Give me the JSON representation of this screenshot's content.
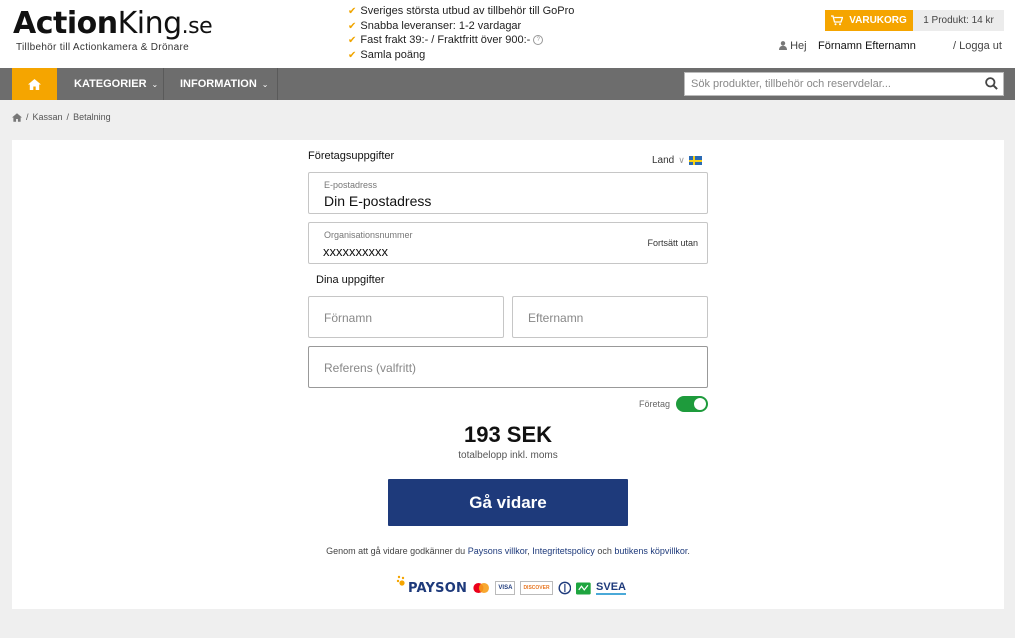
{
  "brand": {
    "logo_action": "Action",
    "logo_king": "King",
    "logo_tld": ".se",
    "tagline": "Tillbehör till Actionkamera & Drönare"
  },
  "usps": [
    "Sveriges största utbud av tillbehör till GoPro",
    "Snabba leveranser: 1-2 vardagar",
    "Fast frakt 39:- / Fraktfritt över 900:-",
    "Samla poäng"
  ],
  "cart": {
    "label": "VARUKORG",
    "summary": "1 Produkt: 14 kr"
  },
  "user": {
    "greeting": "Hej",
    "name": "Förnamn Efternamn",
    "logout": "/ Logga ut"
  },
  "nav": {
    "items": [
      "KATEGORIER",
      "INFORMATION"
    ]
  },
  "search": {
    "placeholder": "Sök produkter, tillbehör och reservdelar..."
  },
  "breadcrumb": {
    "items": [
      "Kassan",
      "Betalning"
    ]
  },
  "checkout": {
    "company_section": "Företagsuppgifter",
    "country_label": "Land",
    "email": {
      "label": "E-postadress",
      "value": "Din E-postadress"
    },
    "org": {
      "label": "Organisationsnummer",
      "value": "xxxxxxxxxx",
      "skip_link": "Fortsätt utan"
    },
    "personal_section": "Dina uppgifter",
    "first_name_placeholder": "Förnamn",
    "last_name_placeholder": "Efternamn",
    "reference_placeholder": "Referens (valfritt)",
    "company_toggle_label": "Företag",
    "company_toggle_on": true,
    "total_amount": "193 SEK",
    "total_caption": "totalbelopp inkl. moms",
    "continue_label": "Gå vidare",
    "terms": {
      "prefix": "Genom att gå vidare godkänner du",
      "link1": "Paysons villkor",
      "sep1": ",",
      "link2": "Integritetspolicy",
      "sep2": "och",
      "link3": "butikens köpvillkor",
      "suffix": "."
    }
  },
  "payments": {
    "payson": "PAYSON",
    "visa": "VISA",
    "discover": "DISCOVER",
    "svea": "SVEA"
  },
  "colors": {
    "accent": "#f5a500",
    "nav": "#6d6d6d",
    "primary": "#1e3a7b",
    "toggle": "#1e9b3c"
  }
}
